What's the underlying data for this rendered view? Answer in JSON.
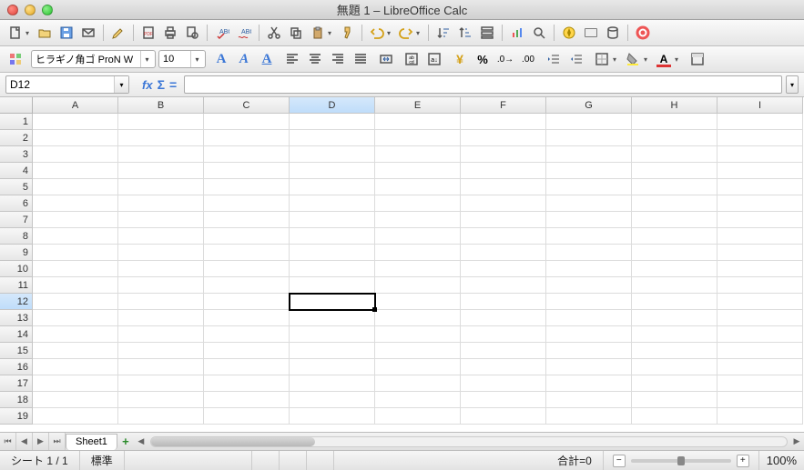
{
  "window": {
    "title": "無題 1 – LibreOffice Calc"
  },
  "font": {
    "name": "ヒラギノ角ゴ ProN W",
    "size": "10"
  },
  "cellref": {
    "value": "D12"
  },
  "formula": {
    "value": ""
  },
  "columns": [
    "A",
    "B",
    "C",
    "D",
    "E",
    "F",
    "G",
    "H",
    "I"
  ],
  "rows": [
    "1",
    "2",
    "3",
    "4",
    "5",
    "6",
    "7",
    "8",
    "9",
    "10",
    "11",
    "12",
    "13",
    "14",
    "15",
    "16",
    "17",
    "18",
    "19"
  ],
  "active": {
    "col": "D",
    "row": "12"
  },
  "sheet": {
    "name": "Sheet1"
  },
  "status": {
    "sheetcount": "シート 1 / 1",
    "style": "標準",
    "sum": "合計=0",
    "zoom": "100%"
  }
}
